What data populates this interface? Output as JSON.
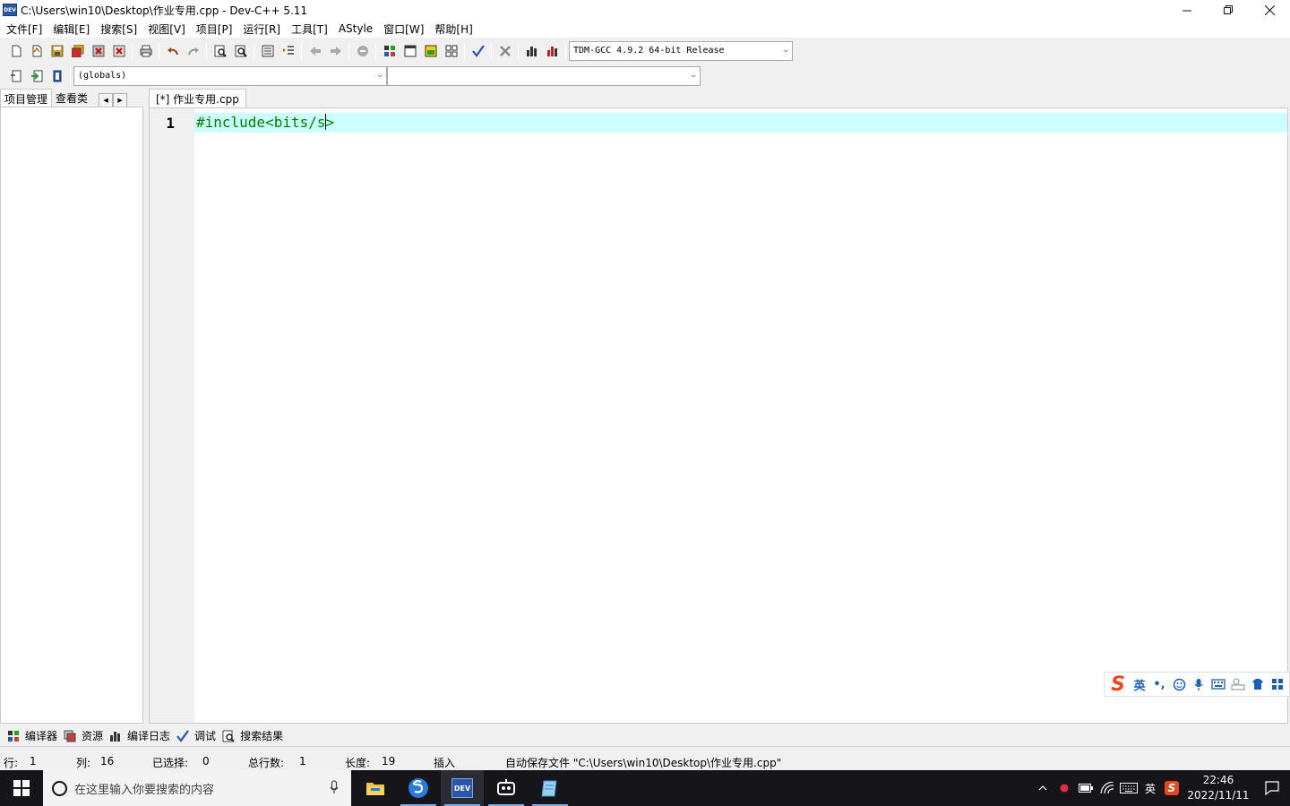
{
  "window": {
    "app_icon_text": "DEV",
    "title": "C:\\Users\\win10\\Desktop\\作业专用.cpp - Dev-C++ 5.11"
  },
  "menu": [
    "文件[F]",
    "编辑[E]",
    "搜索[S]",
    "视图[V]",
    "项目[P]",
    "运行[R]",
    "工具[T]",
    "AStyle",
    "窗口[W]",
    "帮助[H]"
  ],
  "toolbar": {
    "compiler_select": "TDM-GCC 4.9.2 64-bit Release",
    "scope_select": "(globals)",
    "member_select": ""
  },
  "left_panel": {
    "tabs": [
      "项目管理",
      "查看类"
    ]
  },
  "editor": {
    "tab_label": "[*] 作业专用.cpp",
    "line_number": "1",
    "code_before_caret": "#include<bits/s",
    "code_after_caret": ">",
    "current_line_color": "#ccffff",
    "code_color": "#008000"
  },
  "ime": {
    "logo": "S",
    "lang": "英",
    "punct": "•,"
  },
  "bottom_tabs": [
    "编译器",
    "资源",
    "编译日志",
    "调试",
    "搜索结果"
  ],
  "status": {
    "row_label": "行:",
    "row_value": "1",
    "col_label": "列:",
    "col_value": "16",
    "sel_label": "已选择:",
    "sel_value": "0",
    "lines_label": "总行数:",
    "lines_value": "1",
    "len_label": "长度:",
    "len_value": "19",
    "mode": "插入",
    "message": "自动保存文件 \"C:\\Users\\win10\\Desktop\\作业专用.cpp\""
  },
  "taskbar": {
    "search_placeholder": "在这里输入你要搜索的内容",
    "dev_icon_text": "DEV",
    "tray_lang": "英",
    "tray_ime": "S",
    "time": "22:46",
    "date": "2022/11/11"
  }
}
